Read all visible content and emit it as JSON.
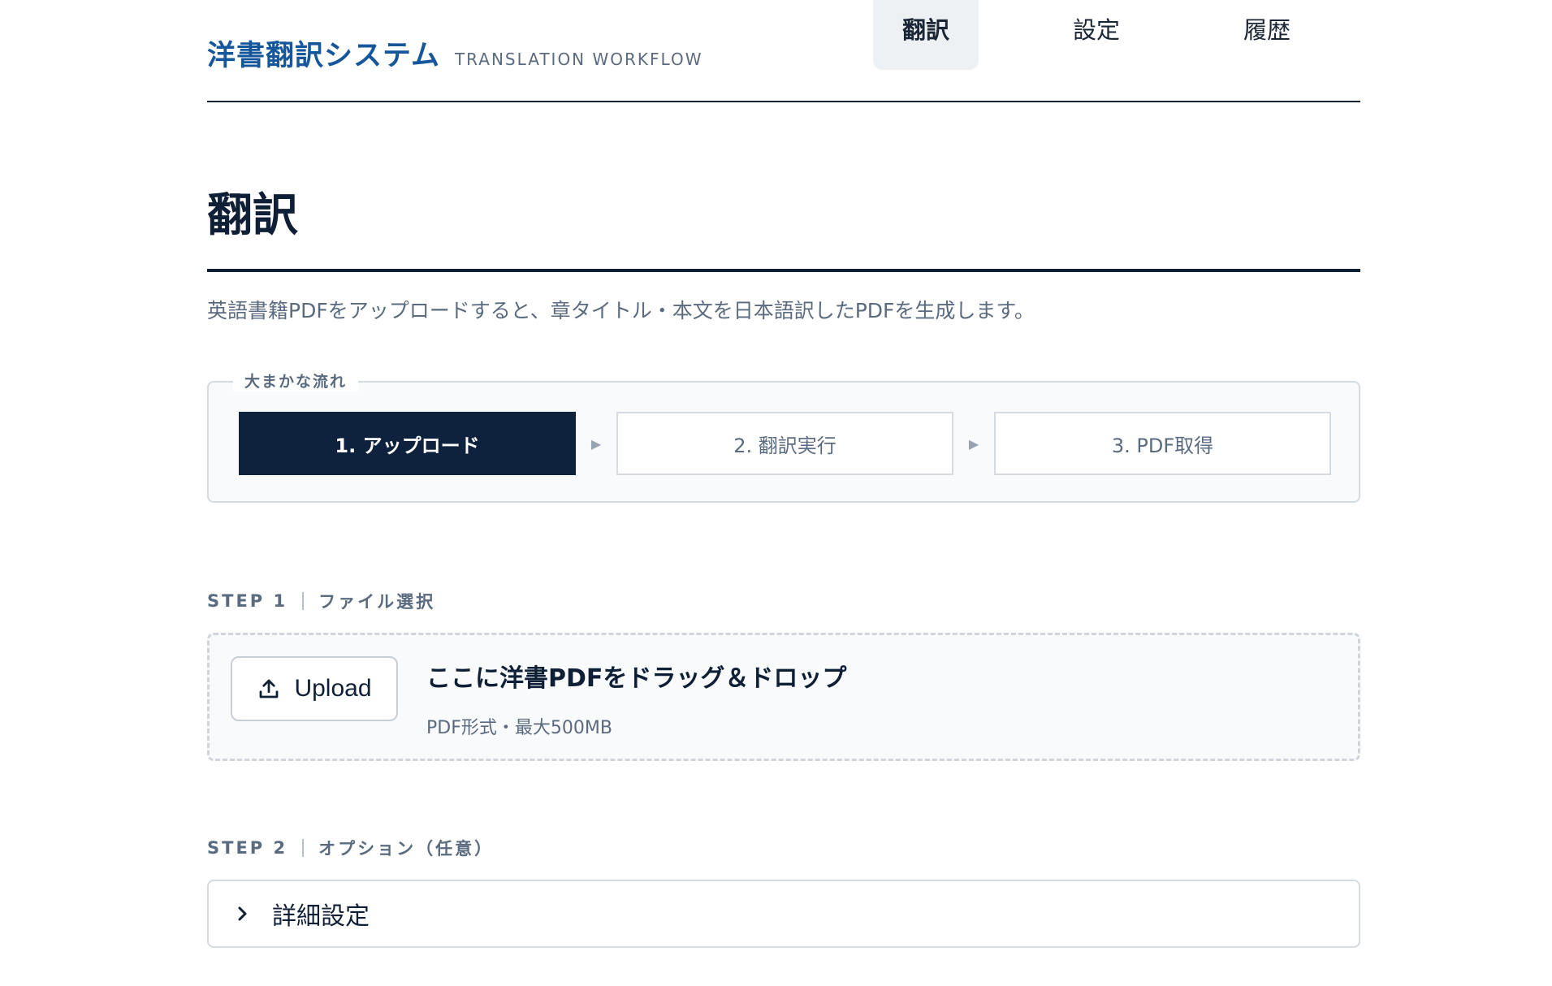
{
  "brand": {
    "title": "洋書翻訳システム",
    "subtitle": "TRANSLATION WORKFLOW"
  },
  "nav": {
    "items": [
      {
        "label": "翻訳",
        "active": true
      },
      {
        "label": "設定",
        "active": false
      },
      {
        "label": "履歴",
        "active": false
      }
    ]
  },
  "page": {
    "title": "翻訳",
    "description": "英語書籍PDFをアップロードすると、章タイトル・本文を日本語訳したPDFを生成します。"
  },
  "flow": {
    "legend": "大まかな流れ",
    "steps": [
      {
        "label": "1. アップロード",
        "active": true
      },
      {
        "label": "2. 翻訳実行",
        "active": false
      },
      {
        "label": "3. PDF取得",
        "active": false
      }
    ],
    "arrow_icon": "triangle-right-icon"
  },
  "step1": {
    "number": "STEP 1",
    "title": "ファイル選択",
    "upload_label": "Upload",
    "upload_icon": "upload-icon",
    "drop_title": "ここに洋書PDFをドラッグ＆ドロップ",
    "drop_note": "PDF形式・最大500MB"
  },
  "step2": {
    "number": "STEP 2",
    "title": "オプション（任意）",
    "details_label": "詳細設定",
    "details_icon": "chevron-right-icon"
  },
  "colors": {
    "brand": "#15579a",
    "dark": "#0e213d",
    "muted": "#5b6b7f",
    "border": "#d6dbe1"
  }
}
